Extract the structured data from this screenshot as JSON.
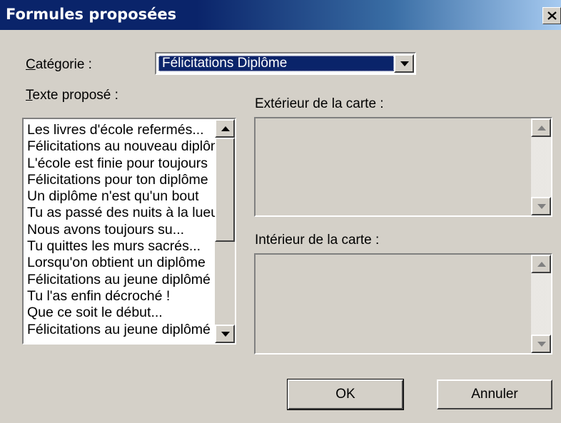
{
  "window": {
    "title": "Formules proposées"
  },
  "category": {
    "label_accel": "C",
    "label_rest": "atégorie :",
    "selected": "Félicitations Diplôme"
  },
  "texts": {
    "label_accel": "T",
    "label_rest": "exte proposé :",
    "items": [
      "Les livres d'école refermés...",
      "Félicitations au nouveau diplômé",
      "L'école est finie pour toujours",
      "Félicitations pour ton diplôme",
      "Un diplôme n'est qu'un bout",
      "Tu as passé des nuits à la lueur",
      "Nous avons toujours su...",
      "Tu quittes les murs sacrés...",
      "Lorsqu'on obtient un diplôme",
      "Félicitations au jeune diplômé",
      "Tu l'as enfin décroché !",
      "Que ce soit le début...",
      "Félicitations au jeune diplômé"
    ]
  },
  "outside": {
    "label": "Extérieur de la carte :",
    "value": ""
  },
  "inside": {
    "label": "Intérieur de la carte :",
    "value": ""
  },
  "buttons": {
    "ok": "OK",
    "cancel": "Annuler"
  }
}
